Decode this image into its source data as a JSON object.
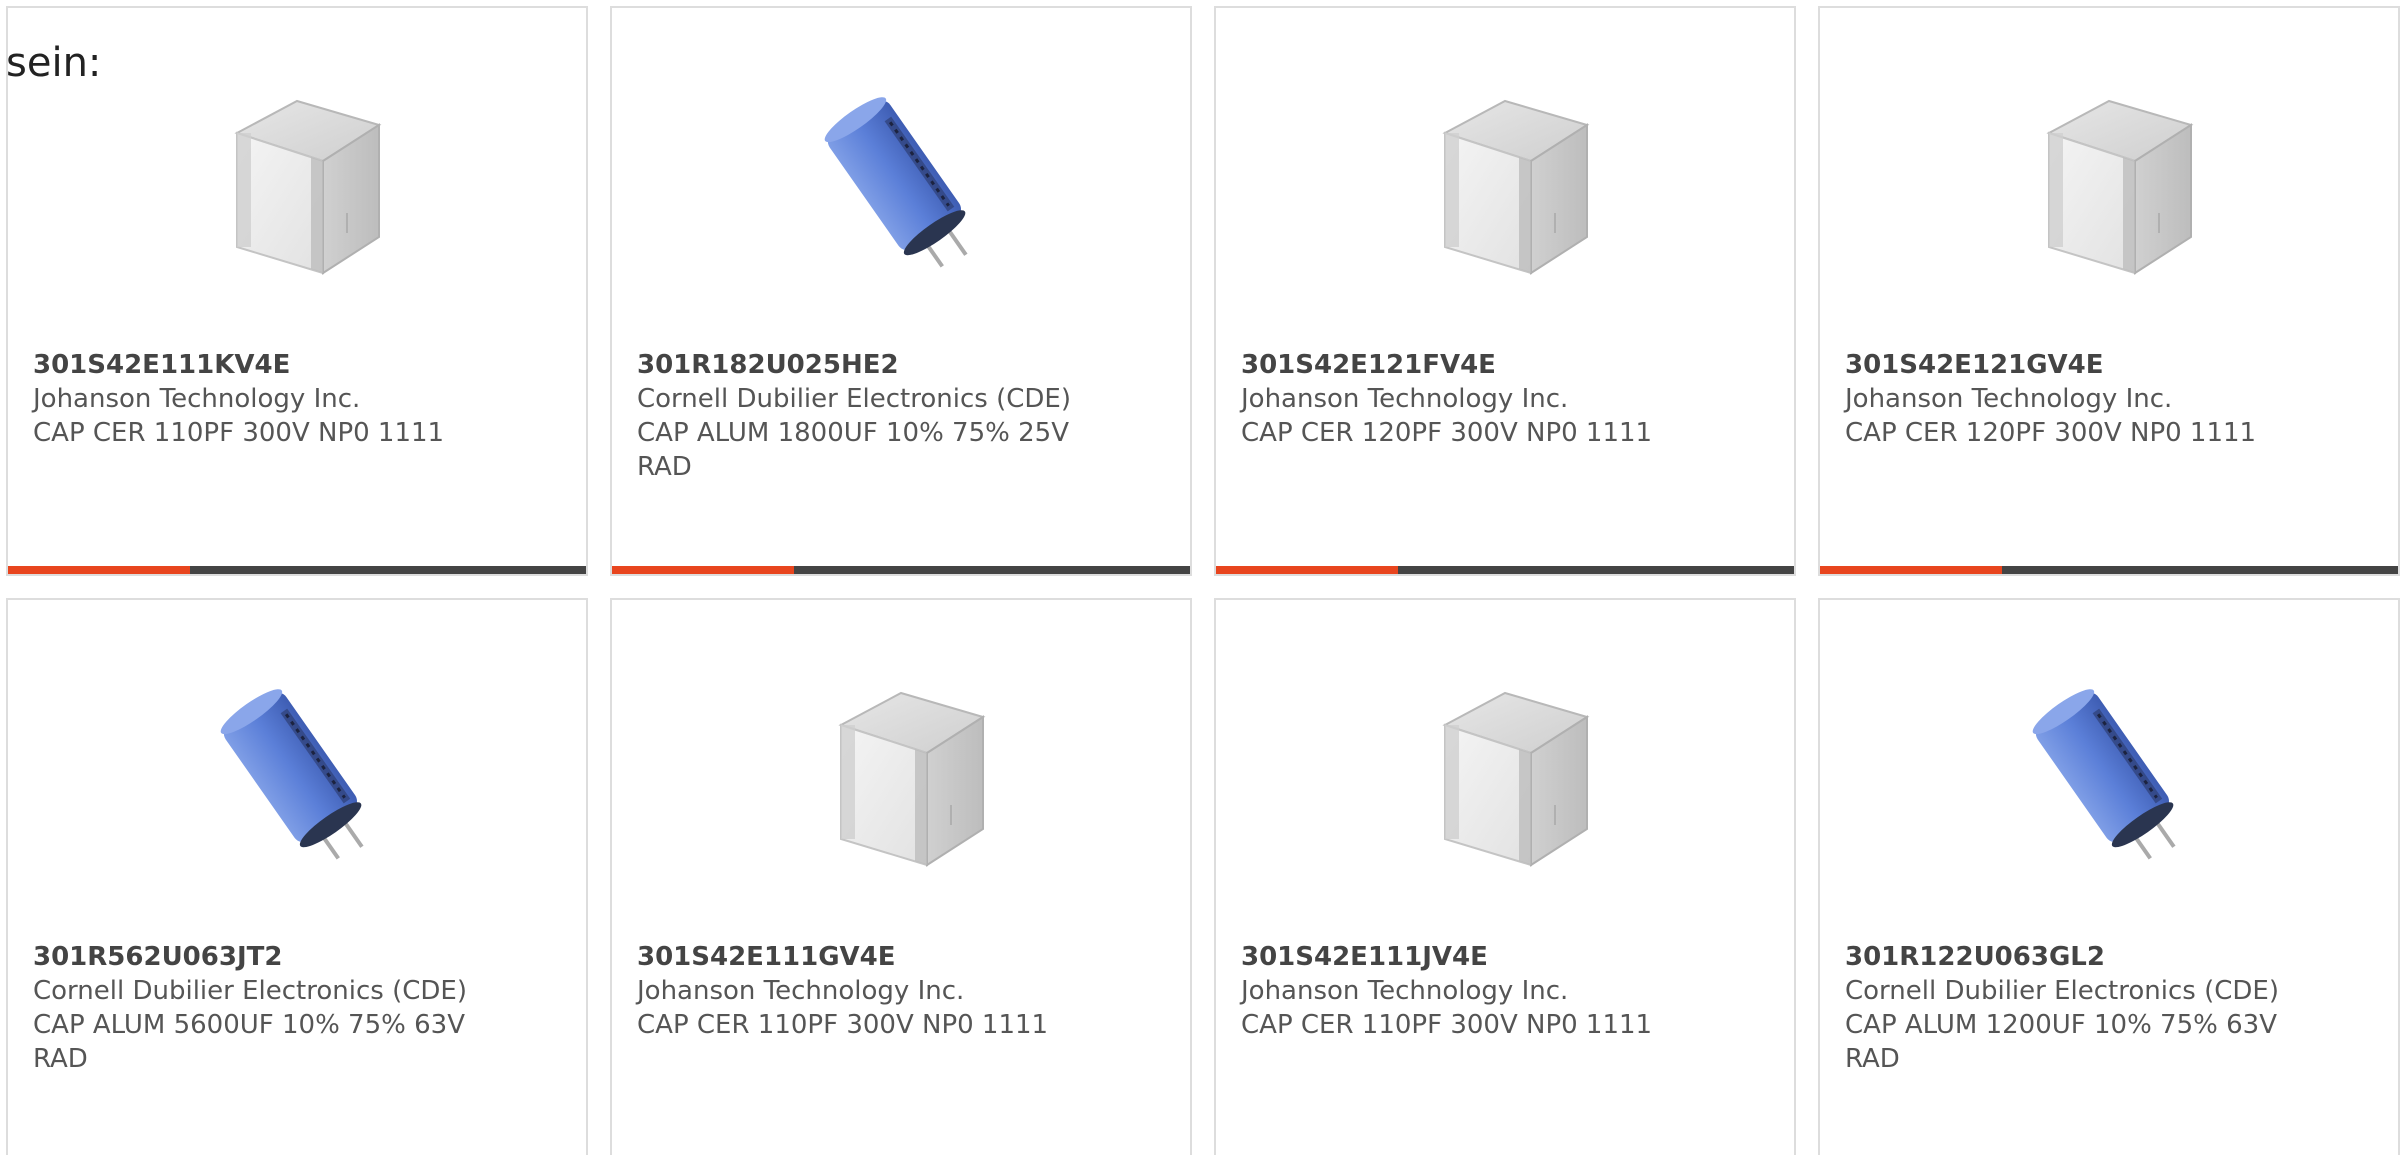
{
  "page": {
    "label": "sein:"
  },
  "colors": {
    "accent": "#e8451e",
    "bar": "#444444",
    "border": "#dddddd",
    "text": "#555555"
  },
  "products": [
    {
      "part_number": "301S42E111KV4E",
      "manufacturer": "Johanson Technology Inc.",
      "description": "CAP CER 110PF 300V NP0 1111",
      "image": "ceramic-capacitor-icon"
    },
    {
      "part_number": "301R182U025HE2",
      "manufacturer": "Cornell Dubilier Electronics (CDE)",
      "description": "CAP ALUM 1800UF 10% 75% 25V RAD",
      "image": "electrolytic-capacitor-icon"
    },
    {
      "part_number": "301S42E121FV4E",
      "manufacturer": "Johanson Technology Inc.",
      "description": "CAP CER 120PF 300V NP0 1111",
      "image": "ceramic-capacitor-icon"
    },
    {
      "part_number": "301S42E121GV4E",
      "manufacturer": "Johanson Technology Inc.",
      "description": "CAP CER 120PF 300V NP0 1111",
      "image": "ceramic-capacitor-icon"
    },
    {
      "part_number": "301R562U063JT2",
      "manufacturer": "Cornell Dubilier Electronics (CDE)",
      "description": "CAP ALUM 5600UF 10% 75% 63V RAD",
      "image": "electrolytic-capacitor-icon"
    },
    {
      "part_number": "301S42E111GV4E",
      "manufacturer": "Johanson Technology Inc.",
      "description": "CAP CER 110PF 300V NP0 1111",
      "image": "ceramic-capacitor-icon"
    },
    {
      "part_number": "301S42E111JV4E",
      "manufacturer": "Johanson Technology Inc.",
      "description": "CAP CER 110PF 300V NP0 1111",
      "image": "ceramic-capacitor-icon"
    },
    {
      "part_number": "301R122U063GL2",
      "manufacturer": "Cornell Dubilier Electronics (CDE)",
      "description": "CAP ALUM 1200UF 10% 75% 63V RAD",
      "image": "electrolytic-capacitor-icon"
    }
  ]
}
